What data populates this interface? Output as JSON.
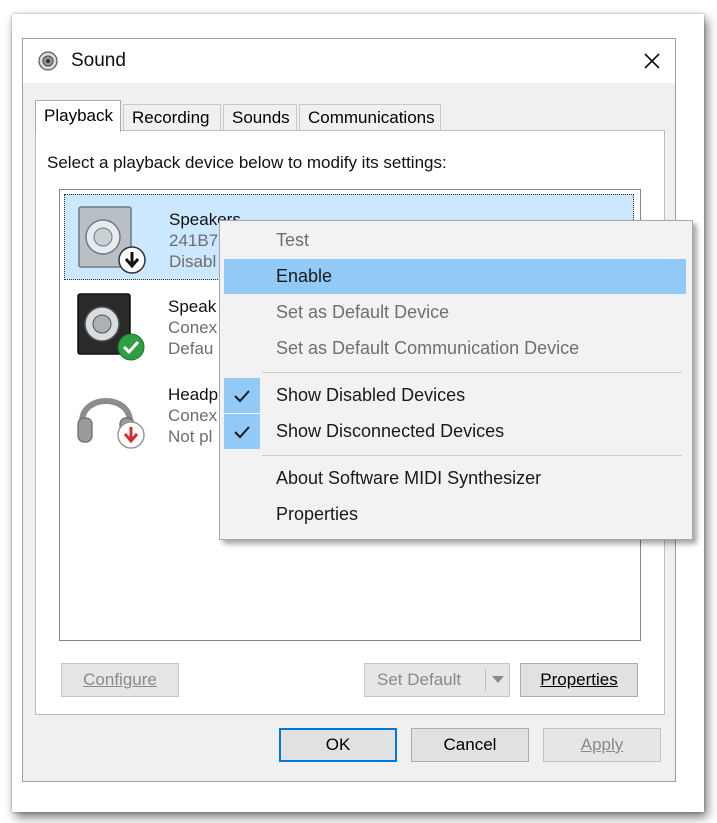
{
  "window": {
    "title": "Sound",
    "close_icon": "close-icon"
  },
  "tabs": [
    {
      "label": "Playback",
      "active": true
    },
    {
      "label": "Recording",
      "active": false
    },
    {
      "label": "Sounds",
      "active": false
    },
    {
      "label": "Communications",
      "active": false
    }
  ],
  "playback": {
    "instruction": "Select a playback device below to modify its settings:",
    "devices": [
      {
        "name": "Speakers",
        "line2": "241B7",
        "line3": "Disabl",
        "icon": "speaker-icon",
        "badge": "arrow-down-badge-icon"
      },
      {
        "name": "Speak",
        "line2": "Conex",
        "line3": "Defau",
        "icon": "speaker-icon",
        "badge": "checkmark-badge-icon"
      },
      {
        "name": "Headp",
        "line2": "Conex",
        "line3": "Not pl",
        "icon": "headphones-icon",
        "badge": "red-arrow-down-badge-icon"
      }
    ],
    "buttons": {
      "configure": "Configure",
      "set_default": "Set Default",
      "properties": "Properties"
    }
  },
  "dialog_buttons": {
    "ok": "OK",
    "cancel": "Cancel",
    "apply": "Apply"
  },
  "context_menu": {
    "items": [
      {
        "label": "Test",
        "state": "disabled"
      },
      {
        "label": "Enable",
        "state": "hover"
      },
      {
        "label": "Set as Default Device",
        "state": "disabled"
      },
      {
        "label": "Set as Default Communication Device",
        "state": "disabled"
      },
      {
        "label": "Show Disabled Devices",
        "state": "checked"
      },
      {
        "label": "Show Disconnected Devices",
        "state": "checked"
      },
      {
        "label": "About Software MIDI Synthesizer",
        "state": "normal"
      },
      {
        "label": "Properties",
        "state": "normal"
      }
    ]
  },
  "colors": {
    "accent": "#0078d7",
    "menu_hover": "#91c9f7",
    "selected_item": "#cce8ff"
  }
}
